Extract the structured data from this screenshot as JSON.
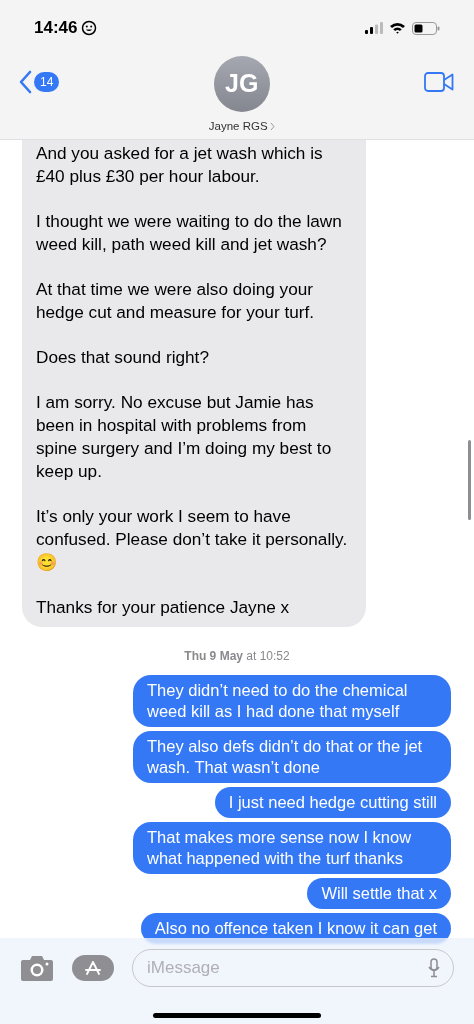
{
  "status_bar": {
    "time": "14:46"
  },
  "header": {
    "back_badge": "14",
    "avatar_initials": "JG",
    "contact_name": "Jayne RGS"
  },
  "messages": [
    {
      "kind": "received",
      "paragraphs": [
        "And you asked for a jet wash which is £40 plus £30 per hour labour.",
        "I thought we were waiting to do the lawn weed kill, path weed kill and jet wash?",
        "At that time we were also doing your hedge cut and measure for your turf.",
        "Does that sound right?",
        "I am sorry. No excuse but Jamie has been in hospital with problems from spine surgery and I’m doing my best to keep up.",
        "It’s only your work I seem to have confused. Please don’t take it personally. 😊",
        "Thanks for your patience Jayne x"
      ]
    },
    {
      "kind": "timestamp",
      "text": "**Thu 9 May** at 10:52"
    },
    {
      "kind": "sent",
      "paragraphs": [
        "They didn’t need to do the chemical weed kill as I had done that myself"
      ]
    },
    {
      "kind": "sent",
      "paragraphs": [
        "They also defs didn’t do that or the jet wash. That wasn’t done"
      ]
    },
    {
      "kind": "sent",
      "paragraphs": [
        "I just need hedge cutting still"
      ]
    },
    {
      "kind": "sent",
      "paragraphs": [
        "That makes more sense now I know what happened with the turf thanks"
      ]
    },
    {
      "kind": "sent",
      "paragraphs": [
        "Will settle that x"
      ]
    },
    {
      "kind": "sent",
      "paragraphs": [
        "Also no offence taken I know it can get"
      ]
    }
  ],
  "composer": {
    "placeholder": "iMessage"
  }
}
